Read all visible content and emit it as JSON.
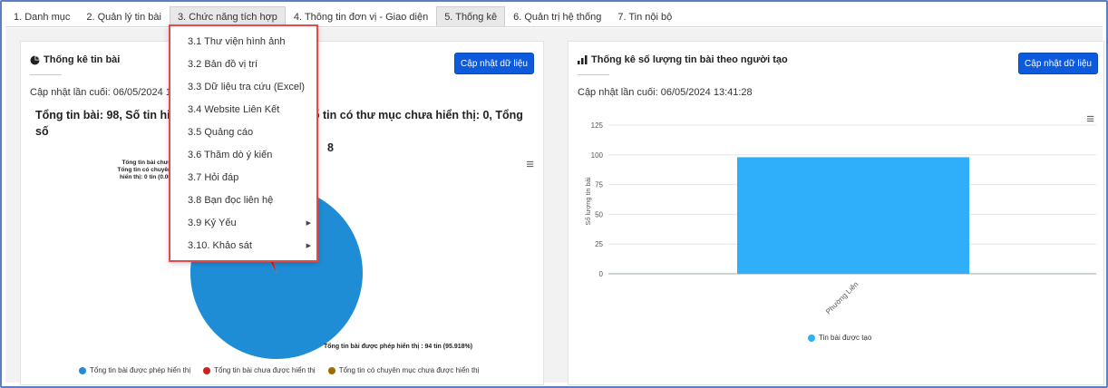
{
  "nav": {
    "tabs": [
      {
        "label": "1. Danh mục"
      },
      {
        "label": "2. Quản lý tin bài"
      },
      {
        "label": "3. Chức năng tích hợp"
      },
      {
        "label": "4. Thông tin đơn vị - Giao diện"
      },
      {
        "label": "5. Thống kê"
      },
      {
        "label": "6. Quản trị hệ thống"
      },
      {
        "label": "7. Tin nội bộ"
      }
    ]
  },
  "dropdown": {
    "items": [
      {
        "label": "3.1 Thư viện hình ảnh"
      },
      {
        "label": "3.2 Bản đồ vị trí"
      },
      {
        "label": "3.3 Dữ liệu tra cứu (Excel)"
      },
      {
        "label": "3.4 Website Liên Kết"
      },
      {
        "label": "3.5 Quảng cáo"
      },
      {
        "label": "3.6 Thăm dò ý kiến"
      },
      {
        "label": "3.7 Hỏi đáp"
      },
      {
        "label": "3.8 Bạn đọc liên hệ"
      },
      {
        "label": "3.9 Kỷ Yếu"
      },
      {
        "label": "3.10. Khảo sát"
      }
    ]
  },
  "left_panel": {
    "title": "Thống kê tin bài",
    "update_button": "Cập nhật dữ liệu",
    "last_update": "Cập nhật lần cuối: 06/05/2024 13",
    "summary_line1_a": "Tổng tin bài: 98, Số tin hiể",
    "summary_line1_b": "Số tin có thư mục chưa hiển thị: 0, Tổng số",
    "summary_line2": "8",
    "pie_label_top_1": "Tổng tin bài chưa",
    "pie_label_top_2": "Tổng tin có chuyên",
    "pie_label_top_3": "hiển thị: 0 tin (0.00",
    "pie_label_bottom": "Tổng tin bài được phép hiển thị : 94 tin (95.918%)"
  },
  "right_panel": {
    "title": "Thống kê số lượng tin bài theo người tạo",
    "update_button": "Cập nhật dữ liệu",
    "last_update": "Cập nhật lần cuối: 06/05/2024 13:41:28"
  },
  "colors": {
    "pie_shown": "#1f8dd6",
    "pie_hidden": "#d21f1f",
    "pie_folder_hidden": "#9e6b00",
    "bar": "#2eaff8",
    "accent_button": "#0d5bdc",
    "dropdown_border": "#e84a4a"
  },
  "chart_data": [
    {
      "type": "pie",
      "title": "",
      "series": [
        {
          "name": "Tổng tin bài được phép hiển thị",
          "value": 94
        },
        {
          "name": "Tổng tin bài chưa được hiển thị",
          "value": 4
        },
        {
          "name": "Tổng tin có chuyên mục chưa được hiển thị",
          "value": 0
        }
      ],
      "legend_position": "bottom"
    },
    {
      "type": "bar",
      "title": "",
      "categories": [
        "Phường Liên"
      ],
      "series": [
        {
          "name": "Tin bài được tạo",
          "values": [
            98
          ]
        }
      ],
      "ylabel": "Số lượng tin bài",
      "ylim": [
        0,
        125
      ],
      "yticks": [
        0,
        25,
        50,
        75,
        100,
        125
      ],
      "grid": true,
      "legend_position": "bottom"
    }
  ]
}
